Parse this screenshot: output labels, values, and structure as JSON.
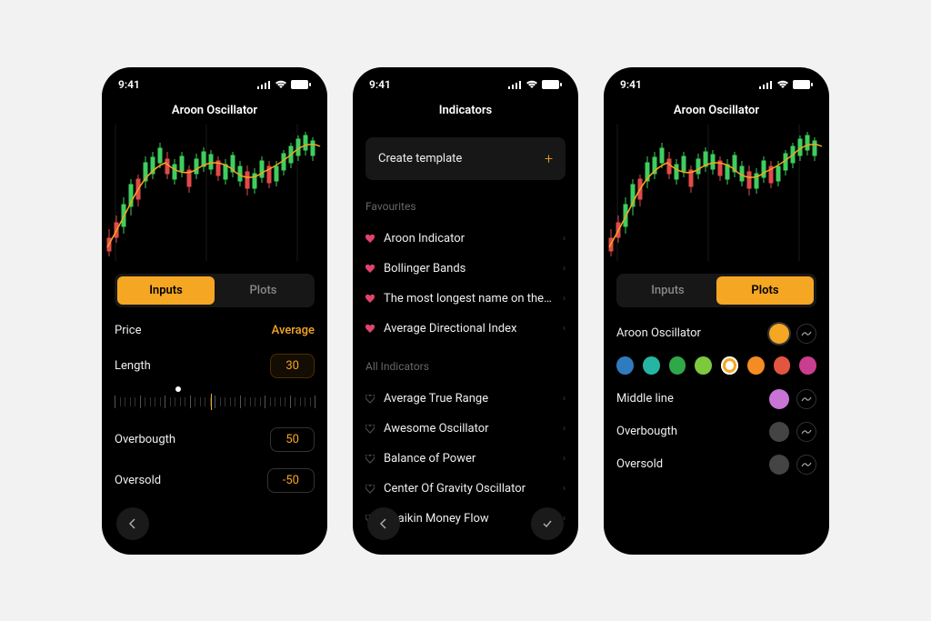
{
  "statusbar": {
    "time": "9:41"
  },
  "screen1": {
    "title": "Aroon Oscillator",
    "tabs": {
      "inputs": "Inputs",
      "plots": "Plots"
    },
    "price_label": "Price",
    "price_value": "Average",
    "length_label": "Length",
    "length_value": "30",
    "overbought_label": "Overbougth",
    "overbought_value": "50",
    "oversold_label": "Oversold",
    "oversold_value": "-50"
  },
  "screen2": {
    "title": "Indicators",
    "create_label": "Create template",
    "favourites_header": "Favourites",
    "favourites": [
      {
        "label": "Aroon Indicator"
      },
      {
        "label": "Bollinger Bands"
      },
      {
        "label": "The most longest name on the pla…"
      },
      {
        "label": "Average Directional Index"
      }
    ],
    "all_header": "All Indicators",
    "all": [
      {
        "label": "Average True Range"
      },
      {
        "label": "Awesome Oscillator"
      },
      {
        "label": "Balance of Power"
      },
      {
        "label": "Center Of Gravity Oscillator"
      },
      {
        "label": "Chaikin Money Flow"
      }
    ]
  },
  "screen3": {
    "title": "Aroon Oscillator",
    "tabs": {
      "inputs": "Inputs",
      "plots": "Plots"
    },
    "rows": [
      {
        "label": "Aroon Oscillator",
        "color": "#f5a623",
        "selected": true
      },
      {
        "label": "Middle line",
        "color": "#c774d6"
      },
      {
        "label": "Overbougth",
        "color": "#444"
      },
      {
        "label": "Oversold",
        "color": "#444"
      }
    ],
    "palette": [
      "#2f7bbf",
      "#26b5a3",
      "#2fa84a",
      "#7cc93e",
      "#f5a623",
      "#f58b23",
      "#e2553f",
      "#c93e8e"
    ],
    "palette_selected_index": 4
  },
  "colors": {
    "candle_up": "#3fce5e",
    "candle_down": "#e24a4a",
    "line": "#f5a623"
  }
}
